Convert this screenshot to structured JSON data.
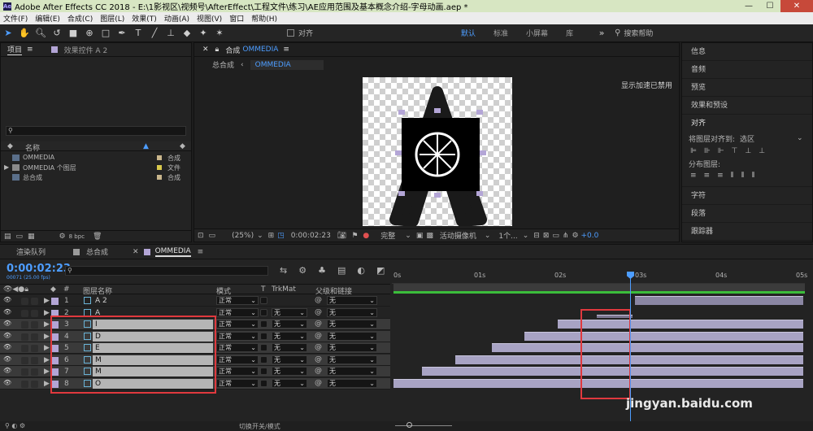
{
  "app": {
    "title": "Adobe After Effects CC 2018 - E:\\1影视区\\视频号\\AfterEffect\\工程文件\\练习\\AE应用范围及基本概念介绍-字母动画.aep *"
  },
  "menu": [
    "文件(F)",
    "编辑(E)",
    "合成(C)",
    "图层(L)",
    "效果(T)",
    "动画(A)",
    "视图(V)",
    "窗口",
    "帮助(H)"
  ],
  "toolbar": {
    "align_label": "对齐",
    "workspaces": [
      "默认",
      "标准",
      "小屏幕",
      "库"
    ],
    "search_placeholder": "搜索帮助"
  },
  "project": {
    "tabs": [
      "项目",
      "效果控件 A 2"
    ],
    "header_name": "名称",
    "header_type": "",
    "items": [
      {
        "name": "OMMEDIA",
        "type": "合成"
      },
      {
        "name": "OMMEDIA 个图层",
        "type": "文件"
      },
      {
        "name": "总合成",
        "type": "合成"
      }
    ],
    "bpc": "8 bpc"
  },
  "viewer": {
    "tab_label": "合成",
    "tab_comp": "OMMEDIA",
    "breadcrumb": [
      "总合成",
      "OMMEDIA"
    ],
    "gpu_notice": "显示加速已禁用",
    "zoom": "(25%)",
    "timecode": "0:00:02:23",
    "quality": "完整",
    "camera": "活动摄像机",
    "views": "1个...",
    "exposure": "+0.0"
  },
  "right_panel": {
    "items": [
      "信息",
      "音频",
      "预览",
      "效果和预设"
    ],
    "align": {
      "title": "对齐",
      "align_to_label": "将图层对齐到:",
      "align_to_value": "选区",
      "distribute_label": "分布图层:"
    },
    "items_bottom": [
      "字符",
      "段落",
      "跟踪器"
    ]
  },
  "timeline": {
    "tabs": [
      "渲染队列",
      "总合成",
      "OMMEDIA"
    ],
    "timecode": "0:00:02:23",
    "frame_info": "00071 (25.00 fps)",
    "search_placeholder": "",
    "columns": {
      "num": "#",
      "layer_name": "图层名称",
      "mode": "模式",
      "t": "T",
      "trkmat": "TrkMat",
      "parent": "父级和链接"
    },
    "layers": [
      {
        "num": "1",
        "name": "A 2",
        "mode": "正常",
        "trkmat": "",
        "parent": "无"
      },
      {
        "num": "2",
        "name": "A",
        "mode": "正常",
        "trkmat": "无",
        "parent": "无"
      },
      {
        "num": "3",
        "name": "I",
        "mode": "正常",
        "trkmat": "无",
        "parent": "无"
      },
      {
        "num": "4",
        "name": "D",
        "mode": "正常",
        "trkmat": "无",
        "parent": "无"
      },
      {
        "num": "5",
        "name": "E",
        "mode": "正常",
        "trkmat": "无",
        "parent": "无"
      },
      {
        "num": "6",
        "name": "M",
        "mode": "正常",
        "trkmat": "无",
        "parent": "无"
      },
      {
        "num": "7",
        "name": "M",
        "mode": "正常",
        "trkmat": "无",
        "parent": "无"
      },
      {
        "num": "8",
        "name": "O",
        "mode": "正常",
        "trkmat": "无",
        "parent": "无"
      }
    ],
    "ruler": [
      "0s",
      "01s",
      "02s",
      "03s",
      "04s",
      "05s"
    ],
    "toggle_label": "切换开关/模式"
  },
  "watermark": "jingyan.baidu.com",
  "colors": {
    "accent": "#4d9dff",
    "label_lavender": "#b3a5d6",
    "highlight_red": "#e0393e",
    "layer_bar": "#a8a3c4"
  }
}
